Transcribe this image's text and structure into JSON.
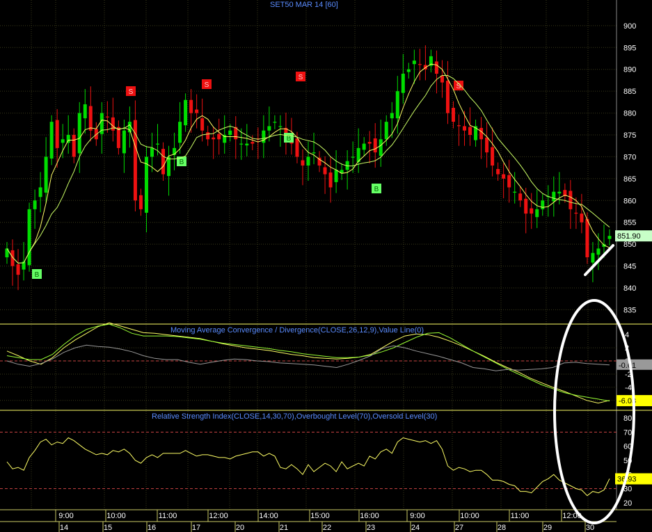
{
  "title": "SET50 MAR 14   [60]",
  "colors": {
    "bg": "#000000",
    "grid": "#3a3a1a",
    "up": "#00dd00",
    "down": "#ee1111",
    "ma_fast": "#ffff66",
    "ma_slow": "#ccff66",
    "axis_text": "#ffffff",
    "title": "#5a8cff",
    "divider": "#ffff66",
    "price_tag": "#c8ffc8",
    "value_tag": "#ffff00",
    "ref_line": "#cc4444",
    "annotation": "#ffffff"
  },
  "chart_data": [
    {
      "type": "candlestick",
      "panel": "price",
      "title": "SET50 MAR 14   [60]",
      "y_ticks": [
        900,
        895,
        890,
        885,
        880,
        875,
        870,
        865,
        860,
        855,
        850,
        845,
        840,
        835
      ],
      "ylim": [
        833,
        903
      ],
      "last_price_label": "851.90",
      "close": [
        849,
        845,
        843,
        846,
        858,
        860,
        863,
        870,
        878,
        872,
        874,
        875,
        870,
        880,
        882,
        876,
        874,
        880,
        879,
        876,
        872,
        876,
        878,
        860,
        858,
        870,
        872,
        873,
        866,
        870,
        872,
        878,
        883,
        880,
        880,
        876,
        874,
        874,
        874,
        875,
        876,
        874,
        873,
        873,
        873,
        874,
        876,
        877,
        878,
        877,
        874,
        873,
        870,
        868,
        870,
        871,
        868,
        866,
        863,
        867,
        867,
        869,
        870,
        872,
        873,
        873,
        871,
        874,
        878,
        880,
        885,
        889,
        890,
        892,
        891,
        890,
        893,
        889,
        887,
        880,
        878,
        877,
        876,
        875,
        877,
        874,
        871,
        868,
        866,
        865,
        863,
        862,
        860,
        857,
        857,
        858,
        860,
        861,
        862,
        862,
        861,
        858,
        857,
        855,
        847,
        848,
        849,
        850,
        851.9
      ],
      "buy_signals": [
        "14",
        "16",
        "21",
        "23"
      ],
      "sell_signals": [
        "15",
        "17",
        "21",
        "27"
      ]
    },
    {
      "type": "line",
      "panel": "macd",
      "title": "Moving Average Convergence / Divergence(CLOSE,26,12,9),Value Line(0)",
      "y_ticks": [
        "4",
        "2",
        "0",
        "-2",
        "-4",
        "-6"
      ],
      "ylim": [
        -7.5,
        5.5
      ],
      "value_labels": [
        "-0.61",
        "-6.03"
      ],
      "series": [
        {
          "values": [
            1.5,
            0.8,
            0,
            -0.5,
            0.5,
            2,
            3.2,
            4.2,
            5.2,
            5.8,
            5.3,
            4.8,
            4.3,
            4.2,
            4.0,
            3.8,
            3.6,
            3.4,
            3.0,
            2.6,
            2.3,
            2.0,
            1.8,
            1.6,
            1.3,
            1.0,
            0.8,
            0.5,
            0.4,
            0.3,
            0.4,
            0.6,
            1.0,
            2.0,
            3.0,
            3.8,
            4.1,
            4.0,
            3.6,
            3.0,
            2.3,
            1.5,
            0.7,
            -0.2,
            -1.0,
            -1.7,
            -2.6,
            -3.3,
            -4.0,
            -4.6,
            -5.3,
            -6.0,
            -6.4,
            -6.0
          ]
        },
        {
          "values": [
            0.8,
            0.5,
            0.2,
            0.2,
            1.0,
            2.5,
            3.8,
            4.8,
            5.3,
            5.6,
            5.0,
            4.2,
            3.8,
            3.8,
            3.8,
            3.7,
            3.5,
            3.3,
            3.0,
            2.7,
            2.5,
            2.3,
            2.1,
            1.9,
            1.6,
            1.4,
            1.1,
            0.9,
            0.7,
            0.5,
            0.5,
            0.6,
            0.9,
            1.4,
            2.0,
            2.8,
            3.6,
            4.2,
            4.3,
            3.5,
            2.5,
            1.5,
            0.6,
            -0.3,
            -1.2,
            -2.0,
            -2.8,
            -3.6,
            -4.2,
            -4.8,
            -5.2,
            -5.5,
            -5.8,
            -6.1
          ]
        },
        {
          "values": [
            0,
            -0.5,
            -0.8,
            -0.4,
            0.3,
            1.3,
            2.0,
            2.4,
            2.2,
            2.1,
            1.8,
            1.4,
            0.8,
            0.4,
            0.2,
            0.2,
            -0.2,
            -0.5,
            -0.2,
            0.1,
            0.3,
            0.2,
            0.0,
            -0.1,
            -0.3,
            -0.4,
            -0.5,
            -0.6,
            -0.8,
            -1.0,
            -0.5,
            0.1,
            0.8,
            1.9,
            2.3,
            2.0,
            1.5,
            1.1,
            0.7,
            0.2,
            -0.3,
            -1.0,
            -1.2,
            -1.5,
            -1.3,
            -1.4,
            -1.3,
            -1.2,
            -1.0,
            -0.3,
            -0.2,
            -0.4,
            -0.5,
            -0.6
          ]
        }
      ]
    },
    {
      "type": "line",
      "panel": "rsi",
      "title": "Relative Strength Index(CLOSE,14,30,70),Overbought Level(70),Oversold Level(30)",
      "y_ticks": [
        80,
        70,
        60,
        50,
        40,
        30,
        20
      ],
      "ylim": [
        15,
        85
      ],
      "value_label": "36.93",
      "reference_lines": [
        70,
        30
      ],
      "values": [
        49,
        44,
        45,
        43,
        52,
        57,
        63,
        65,
        61,
        63,
        62,
        66,
        64,
        61,
        58,
        56,
        54,
        55,
        54,
        57,
        56,
        58,
        55,
        50,
        48,
        52,
        54,
        52,
        55,
        55,
        55,
        55,
        57,
        55,
        53,
        54,
        54,
        53,
        52,
        52,
        51,
        53,
        54,
        55,
        56,
        56,
        53,
        55,
        53,
        45,
        44,
        47,
        44,
        40,
        47,
        42,
        45,
        48,
        46,
        42,
        49,
        44,
        46,
        48,
        46,
        53,
        51,
        56,
        58,
        55,
        63,
        66,
        65,
        64,
        63,
        64,
        62,
        64,
        58,
        46,
        43,
        45,
        44,
        42,
        43,
        43,
        40,
        36,
        36,
        35,
        33,
        32,
        28,
        28,
        27,
        31,
        35,
        37,
        40,
        36,
        34,
        32,
        30,
        29,
        25,
        28,
        27,
        29,
        37
      ]
    }
  ],
  "x_axis": {
    "times": [
      "9:00",
      "10:00",
      "11:00",
      "12:00",
      "14:00",
      "15:00",
      "16:00",
      "9:00",
      "10:00",
      "11:00",
      "12:00"
    ],
    "dates": [
      "14",
      "15",
      "16",
      "17",
      "20",
      "21",
      "22",
      "23",
      "24",
      "27",
      "28",
      "29",
      "30"
    ]
  }
}
